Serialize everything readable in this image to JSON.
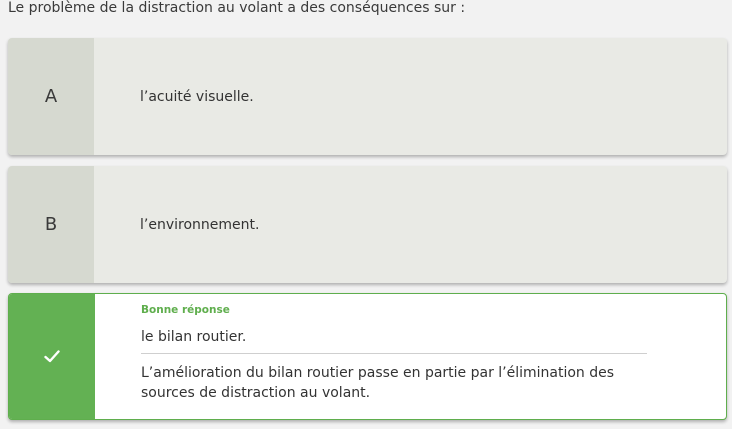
{
  "question": "Le problème de la distraction au volant a des conséquences sur :",
  "answers": [
    {
      "letter": "A",
      "text": "l’acuité visuelle."
    },
    {
      "letter": "B",
      "text": "l’environnement."
    }
  ],
  "correct_answer": {
    "status_label": "Bonne réponse",
    "icon": "checkmark-icon",
    "text": "le bilan routier.",
    "explanation": "L’amélioration du bilan routier passe en partie par l’élimination des sources de distraction au volant."
  },
  "colors": {
    "correct": "#63b153",
    "neutral_card": "#e9eae5",
    "letter_box": "#d6d9d0"
  }
}
